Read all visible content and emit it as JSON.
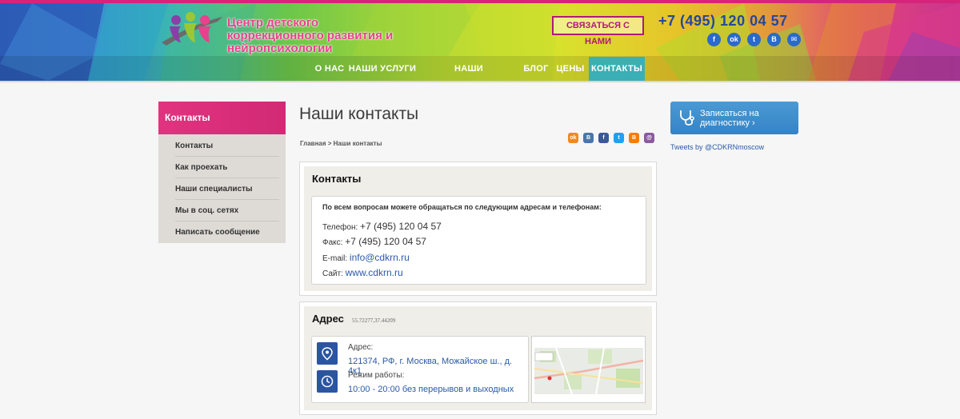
{
  "colors": {
    "brand_pink": "#d6247b",
    "brand_blue": "#24489c",
    "link_blue": "#2a5aa8",
    "nav_active": "#3ab0b4",
    "cta_blue": "#3a8bcb"
  },
  "header": {
    "logo_text": "Центр детского коррекционного развития и нейропсихологии",
    "contact_button": "СВЯЗАТЬСЯ С НАМИ",
    "phone": "+7 (495) 120 04 57",
    "socials": [
      {
        "icon": "facebook-icon",
        "glyph": "f"
      },
      {
        "icon": "odnoklassniki-icon",
        "glyph": "ok"
      },
      {
        "icon": "twitter-icon",
        "glyph": "t"
      },
      {
        "icon": "vkontakte-icon",
        "glyph": "В"
      },
      {
        "icon": "mail-icon",
        "glyph": "✉"
      }
    ]
  },
  "nav": {
    "items": [
      {
        "label": "О НАС"
      },
      {
        "label": "НАШИ УСЛУГИ"
      },
      {
        "label": "НАШИ СПЕЦИАЛИСТЫ"
      },
      {
        "label": "БЛОГ"
      },
      {
        "label": "ЦЕНЫ"
      },
      {
        "label": "КОНТАКТЫ"
      }
    ],
    "active": "КОНТАКТЫ"
  },
  "sidebar": {
    "title": "Контакты",
    "items": [
      {
        "label": "Контакты"
      },
      {
        "label": "Как проехать"
      },
      {
        "label": "Наши специалисты"
      },
      {
        "label": "Мы в соц. сетях"
      },
      {
        "label": "Написать сообщение"
      }
    ]
  },
  "main": {
    "title": "Наши контакты",
    "breadcrumb": "Главная > Наши контакты",
    "share_icons": [
      {
        "icon": "odnoklassniki-icon",
        "glyph": "ok",
        "color": "#f08a1c"
      },
      {
        "icon": "vkontakte-icon",
        "glyph": "В",
        "color": "#4a76a8"
      },
      {
        "icon": "facebook-icon",
        "glyph": "f",
        "color": "#3b5998"
      },
      {
        "icon": "twitter-icon",
        "glyph": "t",
        "color": "#1da1f2"
      },
      {
        "icon": "blogger-icon",
        "glyph": "B",
        "color": "#f57d00"
      },
      {
        "icon": "email-icon",
        "glyph": "@",
        "color": "#8b5a9e"
      }
    ],
    "contacts": {
      "heading": "Контакты",
      "intro": "По всем вопросам можете обращаться по следующим адресам и телефонам:",
      "phone_label": "Телефон:",
      "phone": "+7 (495) 120 04 57",
      "fax_label": "Факс:",
      "fax": "+7 (495) 120 04 57",
      "email_label": "E-mail:",
      "email": "info@cdkrn.ru",
      "site_label": "Сайт:",
      "site": "www.cdkrn.ru"
    },
    "address": {
      "heading": "Адрес",
      "coords": "55.72277,37.44209",
      "address_label": "Адрес:",
      "address": "121374, РФ, г. Москва, Можайское ш., д. 4к1",
      "hours_label": "Режим работы:",
      "hours": "10:00 - 20:00 без перерывов и выходных"
    }
  },
  "right": {
    "cta_label": "Записаться на диагностику ›",
    "tweets": "Tweets by @CDKRNmoscow"
  }
}
